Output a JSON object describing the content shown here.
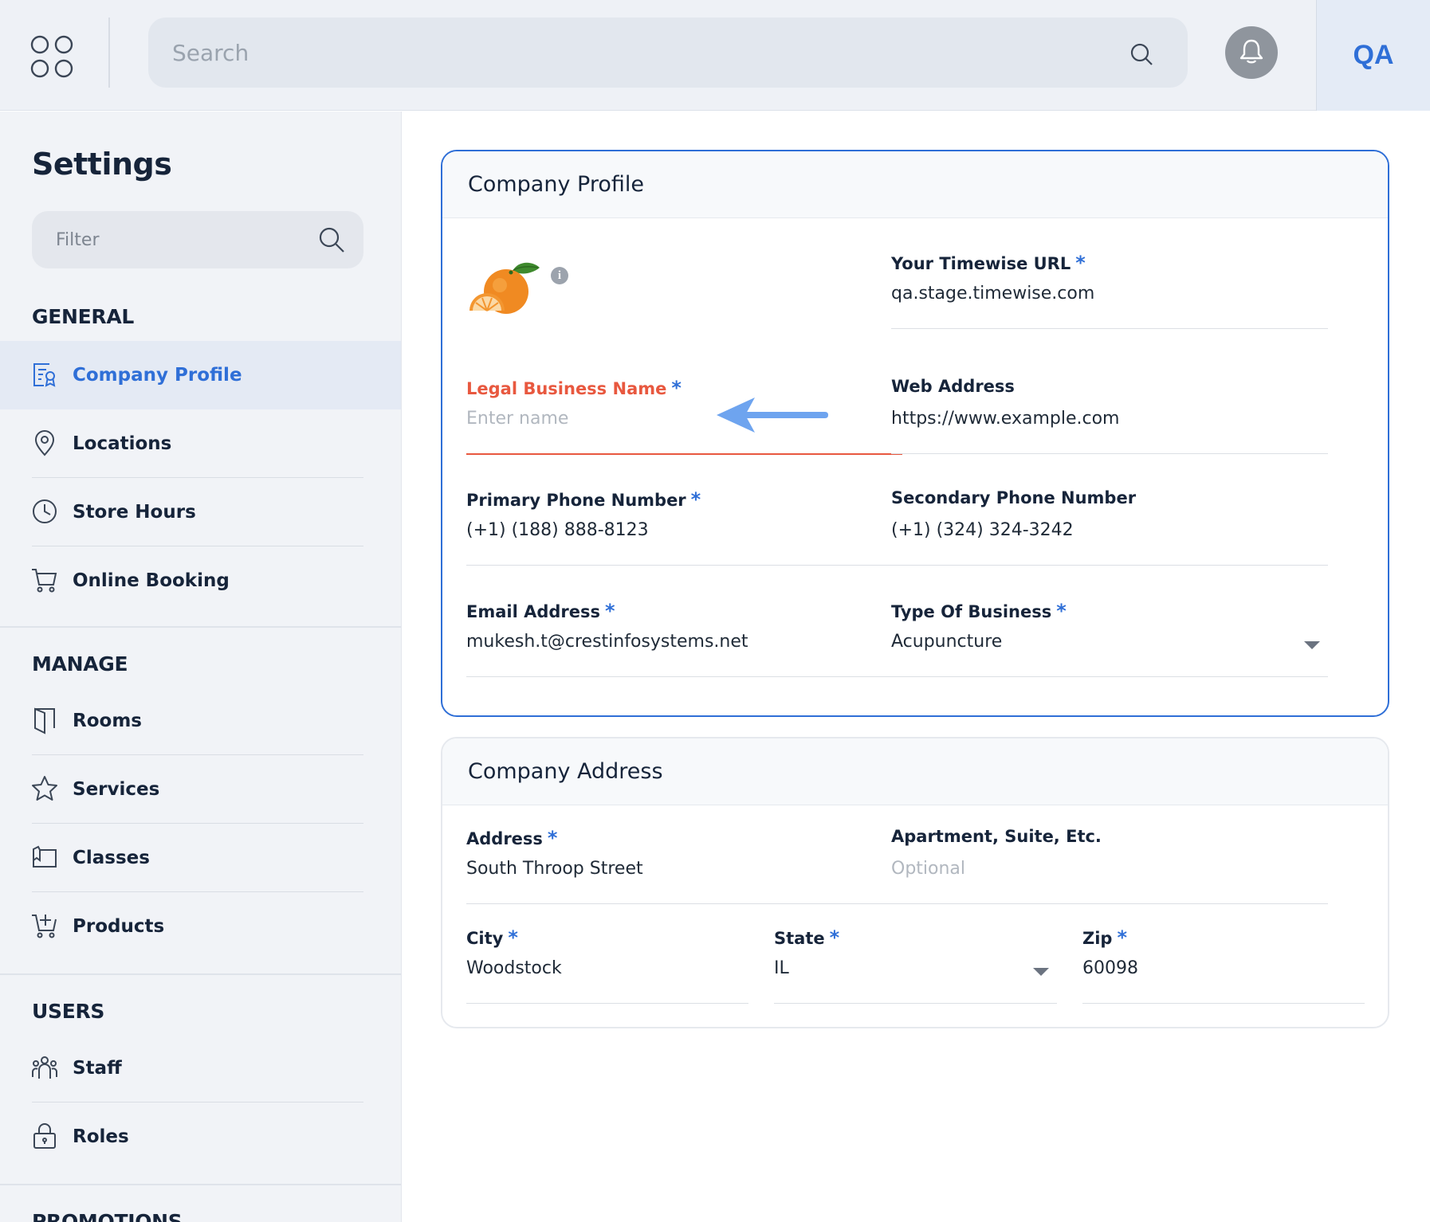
{
  "topbar": {
    "search_placeholder": "Search",
    "avatar_initials": "QA"
  },
  "sidebar": {
    "title": "Settings",
    "filter_placeholder": "Filter",
    "groups": {
      "general": {
        "label": "GENERAL",
        "items": [
          {
            "label": "Company Profile",
            "icon": "company-profile-icon",
            "active": true
          },
          {
            "label": "Locations",
            "icon": "location-pin-icon"
          },
          {
            "label": "Store Hours",
            "icon": "clock-icon"
          },
          {
            "label": "Online Booking",
            "icon": "cart-icon"
          }
        ]
      },
      "manage": {
        "label": "MANAGE",
        "items": [
          {
            "label": "Rooms",
            "icon": "door-icon"
          },
          {
            "label": "Services",
            "icon": "star-icon"
          },
          {
            "label": "Classes",
            "icon": "classes-icon"
          },
          {
            "label": "Products",
            "icon": "cart-plus-icon"
          }
        ]
      },
      "users": {
        "label": "USERS",
        "items": [
          {
            "label": "Staff",
            "icon": "staff-icon"
          },
          {
            "label": "Roles",
            "icon": "lock-icon"
          }
        ]
      },
      "promotions": {
        "label": "PROMOTIONS"
      }
    }
  },
  "company_profile": {
    "title": "Company Profile",
    "fields": {
      "timewise_url": {
        "label": "Your Timewise URL",
        "value": "qa.stage.timewise.com"
      },
      "legal_business_name": {
        "label": "Legal Business Name",
        "value": "",
        "placeholder": "Enter name"
      },
      "web_address": {
        "label": "Web Address",
        "value": "https://www.example.com"
      },
      "primary_phone": {
        "label": "Primary Phone Number",
        "value": "(+1) (188) 888-8123"
      },
      "secondary_phone": {
        "label": "Secondary Phone Number",
        "value": "(+1) (324) 324-3242"
      },
      "email": {
        "label": "Email Address",
        "value": "mukesh.t@crestinfosystems.net"
      },
      "business_type": {
        "label": "Type Of Business",
        "value": "Acupuncture"
      }
    },
    "required_mark": "*",
    "info_glyph": "i"
  },
  "company_address": {
    "title": "Company Address",
    "fields": {
      "address": {
        "label": "Address",
        "value": "South Throop Street"
      },
      "apartment": {
        "label": "Apartment, Suite, Etc.",
        "value": "",
        "placeholder": "Optional"
      },
      "city": {
        "label": "City",
        "value": "Woodstock"
      },
      "state": {
        "label": "State",
        "value": "IL"
      },
      "zip": {
        "label": "Zip",
        "value": "60098"
      }
    }
  },
  "colors": {
    "accent": "#2f6fd7",
    "error": "#e8583f",
    "annotation_arrow": "#6ea4ef",
    "sidebar_bg": "#f1f3f7"
  }
}
